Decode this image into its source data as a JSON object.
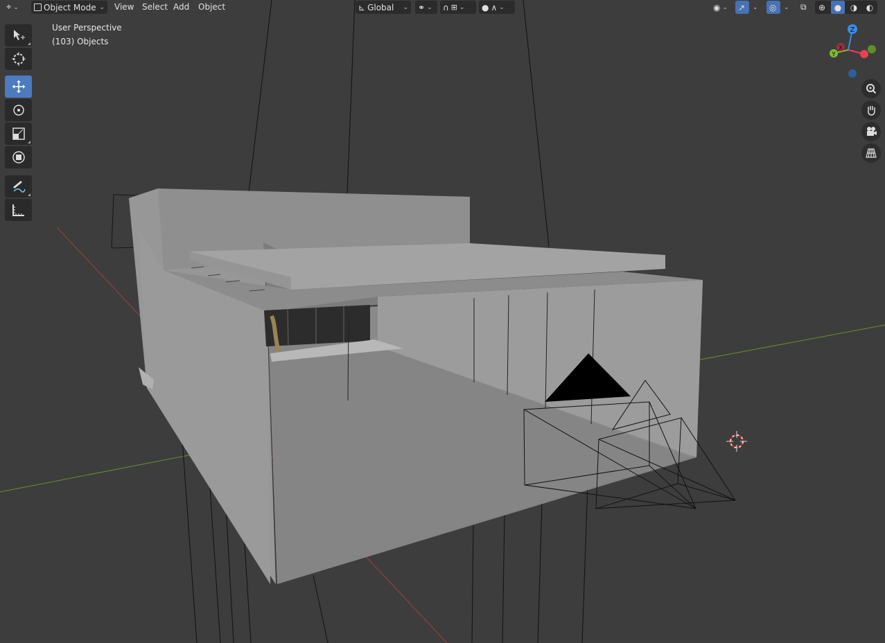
{
  "header": {
    "editor_type_icon": "view3d-icon",
    "mode": {
      "label": "Object Mode",
      "icon": "object-mode-icon"
    },
    "menus": [
      "View",
      "Select",
      "Add",
      "Object"
    ],
    "transform_orientation": {
      "label": "Global",
      "icon": "global-axes-icon"
    },
    "pivot_icon": "pivot-point-icon",
    "snap_icon": "magnet-icon",
    "snap_target_icon": "snap-increment-icon",
    "proportional_icon": "proportional-edit-icon",
    "falloff_icon": "falloff-curve-icon",
    "right_icons": [
      "visibility-eye-icon",
      "gizmo-toggle-icon",
      "overlays-icon",
      "xray-icon",
      "wireframe-shading-icon",
      "solid-shading-icon",
      "material-shading-icon",
      "rendered-shading-icon"
    ]
  },
  "overlay": {
    "view_name": "User Perspective",
    "selection_info": "(103) Objects"
  },
  "toolbar": {
    "tools": [
      "select-box-tool",
      "cursor-tool",
      "move-tool",
      "rotate-tool",
      "scale-tool",
      "transform-tool",
      "annotate-tool",
      "measure-tool"
    ],
    "active_tool": "move-tool"
  },
  "nav_gizmo": {
    "axes": [
      "Z",
      "X",
      "Y"
    ],
    "colors": {
      "x": "#e8414f",
      "y": "#7ebd30",
      "z": "#3b8ce6"
    },
    "buttons": [
      "zoom-icon",
      "pan-hand-icon",
      "camera-view-icon",
      "ortho-grid-icon"
    ]
  },
  "colors": {
    "background": "#3d3d3d",
    "header_button": "#2b2b2b",
    "accent": "#4772b3",
    "mesh_light": "#a5a5a5",
    "mesh_dark": "#7a7a7a"
  }
}
